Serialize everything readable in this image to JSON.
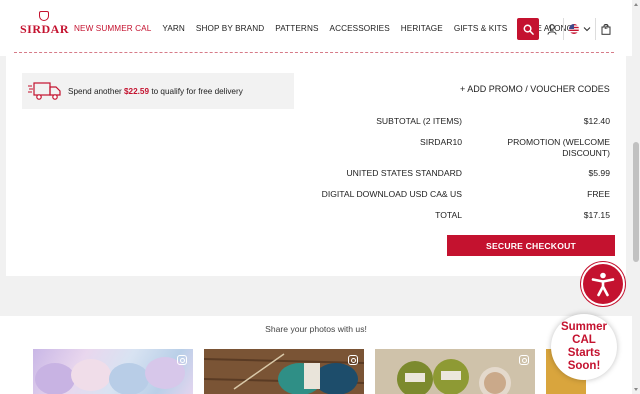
{
  "brand": {
    "logo_text": "SIRDAR",
    "accent_color": "#c4122f"
  },
  "nav": {
    "items": [
      {
        "label": "NEW SUMMER CAL",
        "active": true
      },
      {
        "label": "YARN"
      },
      {
        "label": "SHOP BY BRAND"
      },
      {
        "label": "PATTERNS"
      },
      {
        "label": "ACCESSORIES"
      },
      {
        "label": "HERITAGE"
      },
      {
        "label": "GIFTS & KITS"
      },
      {
        "label": "MAKE ALONG"
      }
    ]
  },
  "header_icons": {
    "search": "search-icon",
    "account": "user-icon",
    "locale": "us-flag-icon",
    "cart": "cart-icon",
    "cart_count": "2"
  },
  "delivery": {
    "prefix": "Spend another ",
    "amount": "$22.59",
    "suffix": " to qualify for free delivery"
  },
  "promo": {
    "label": "+ ADD PROMO / VOUCHER CODES"
  },
  "summary": [
    {
      "label": "SUBTOTAL (2 ITEMS)",
      "value": "$12.40"
    },
    {
      "label": "SIRDAR10",
      "value": "PROMOTION (WELCOME DISCOUNT)"
    },
    {
      "label": "UNITED STATES STANDARD",
      "value": "$5.99"
    },
    {
      "label": "DIGITAL DOWNLOAD USD CA& US",
      "value": "FREE"
    },
    {
      "label": "TOTAL",
      "value": "$17.15"
    }
  ],
  "checkout": {
    "label": "SECURE CHECKOUT"
  },
  "share": {
    "title": "Share your photos with us!"
  },
  "cal_badge": {
    "line1": "Summer",
    "line2": "CAL",
    "line3": "Starts",
    "line4": "Soon!"
  }
}
